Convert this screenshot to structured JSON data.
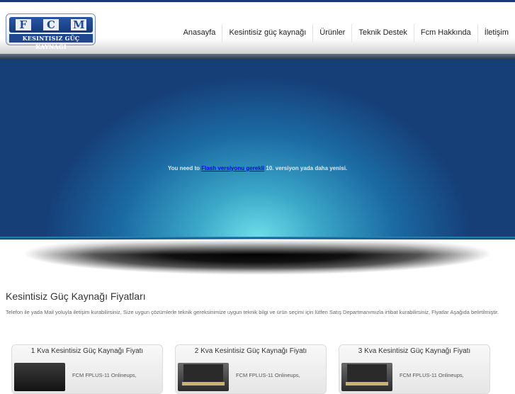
{
  "header": {
    "logo": {
      "letters": [
        "F",
        "C",
        "M"
      ],
      "tagline": "KESINTISIZ GÜÇ KAYNAĞI"
    },
    "nav": [
      "Anasayfa",
      "Kesintisiz güç kaynağı",
      "Ürünler",
      "Teknik Destek",
      "Fcm Hakkında",
      "İletişim"
    ]
  },
  "banner": {
    "prefix": "You need to ",
    "link": "Flash versiyonu gerekli",
    "suffix": " 10. versiyon yada daha yenisi."
  },
  "content": {
    "title": "Kesintisiz Güç Kaynağı Fiyatları",
    "description": "Telefon ile yada Mail yoluyla iletişim kurabilirsiniz, Size uygun çözümlerle teknik gereksinimize uygun teknik bilgi ve ürün seçimi için lütfen Satış Departmanımızla irtibat kurabilirsiniz, Fiyatlar Aşağıda belirtilmiştir."
  },
  "cards": [
    {
      "title": "1 Kva Kesintisiz Güç Kaynağı Fiyatı",
      "text": "FCM FPLUS-11 Onlineups,"
    },
    {
      "title": "2 Kva Kesintisiz Güç Kaynağı Fiyatı",
      "text": "FCM FPLUS-11 Onlineups,"
    },
    {
      "title": "3 Kva Kesintisiz Güç Kaynağı Fiyatı",
      "text": "FCM FPLUS-11 Onlineups,"
    }
  ],
  "colors": {
    "brand_blue": "#1b3b74",
    "banner_glow": "#6fe0ea"
  }
}
